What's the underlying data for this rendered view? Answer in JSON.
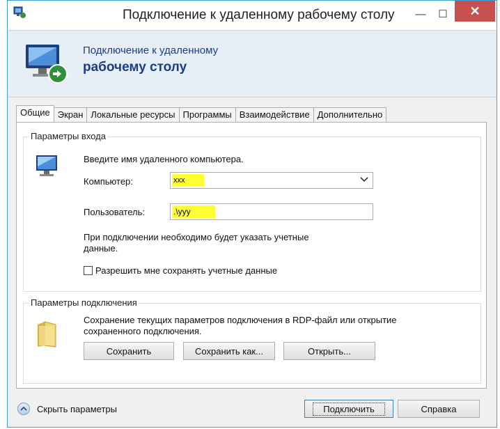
{
  "window": {
    "title": "Подключение к удаленному рабочему столу",
    "minimize_glyph": "—",
    "maximize_glyph": "☐",
    "close_glyph": "✕"
  },
  "header": {
    "line1": "Подключение к удаленному",
    "line2": "рабочему столу"
  },
  "tabs": [
    {
      "label": "Общие",
      "active": true
    },
    {
      "label": "Экран",
      "active": false
    },
    {
      "label": "Локальные ресурсы",
      "active": false
    },
    {
      "label": "Программы",
      "active": false
    },
    {
      "label": "Взаимодействие",
      "active": false
    },
    {
      "label": "Дополнительно",
      "active": false
    }
  ],
  "logon": {
    "group_title": "Параметры входа",
    "instruction": "Введите имя удаленного компьютера.",
    "computer_label": "Компьютер:",
    "computer_value": "xxx",
    "user_label": "Пользователь:",
    "user_value": ".\\yyy",
    "note_line1": "При подключении необходимо будет указать учетные",
    "note_line2": "данные.",
    "save_creds_label": "Разрешить мне сохранять учетные данные",
    "save_creds_checked": false
  },
  "connection": {
    "group_title": "Параметры подключения",
    "desc_line1": "Сохранение текущих параметров подключения в RDP-файл или открытие",
    "desc_line2": "сохраненного подключения.",
    "save_button": "Сохранить",
    "save_as_button": "Сохранить как...",
    "open_button": "Открыть..."
  },
  "footer": {
    "hide_options_label": "Скрыть параметры",
    "connect_button": "Подключить",
    "help_button": "Справка"
  },
  "colors": {
    "highlight": "#ffff33",
    "header_text": "#1e3b8a",
    "close_button": "#c7504c"
  }
}
